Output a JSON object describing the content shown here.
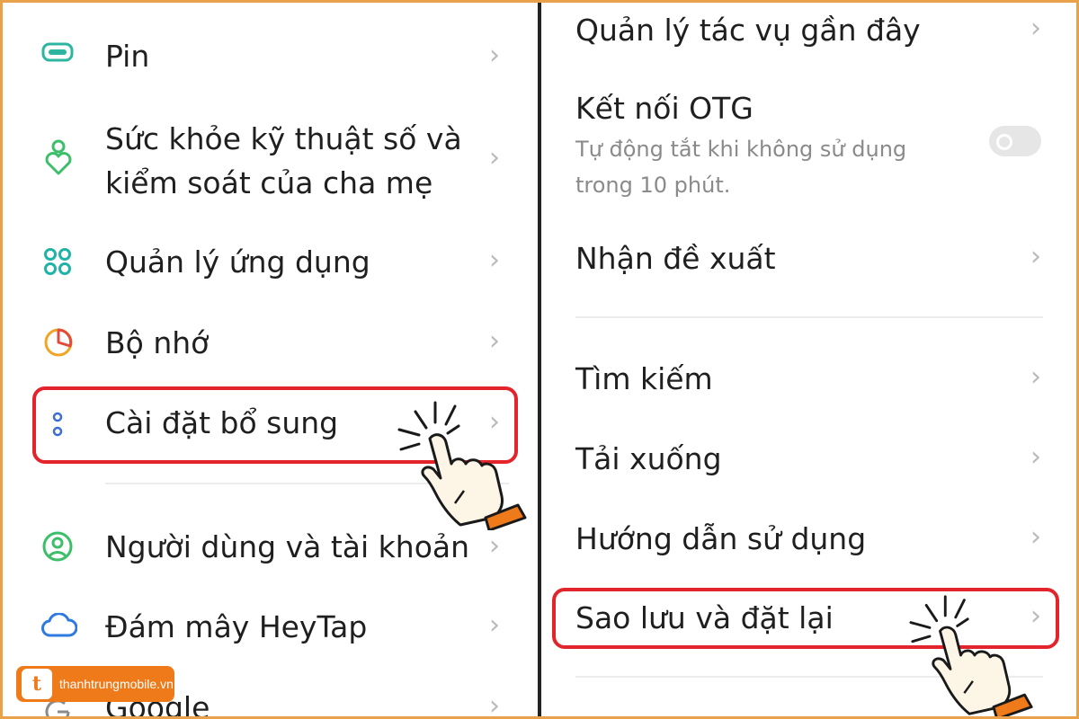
{
  "left_panel": {
    "items": [
      {
        "label": "Pin"
      },
      {
        "label_line1": "Sức khỏe kỹ thuật số và",
        "label_line2": "kiểm soát của cha mẹ"
      },
      {
        "label": "Quản lý ứng dụng"
      },
      {
        "label": "Bộ nhớ"
      },
      {
        "label": "Cài đặt bổ sung"
      },
      {
        "label": "Người dùng và tài khoản"
      },
      {
        "label": "Đám mây HeyTap"
      },
      {
        "label": "Google"
      }
    ]
  },
  "right_panel": {
    "items": [
      {
        "label": "Quản lý tác vụ gần đây"
      },
      {
        "label": "Kết nối OTG",
        "sub_line1": "Tự động tắt khi không sử dụng",
        "sub_line2": "trong 10 phút.",
        "toggle_on": false
      },
      {
        "label": "Nhận đề xuất"
      },
      {
        "label": "Tìm kiếm"
      },
      {
        "label": "Tải xuống"
      },
      {
        "label": "Hướng dẫn sử dụng"
      },
      {
        "label": "Sao lưu và đặt lại"
      }
    ]
  },
  "chevron": "›",
  "watermark": {
    "text": "thanhtrungmobile.vn"
  },
  "colors": {
    "highlight": "#e3242b",
    "accent": "#ef7a1a",
    "frame": "#e9a24a"
  }
}
